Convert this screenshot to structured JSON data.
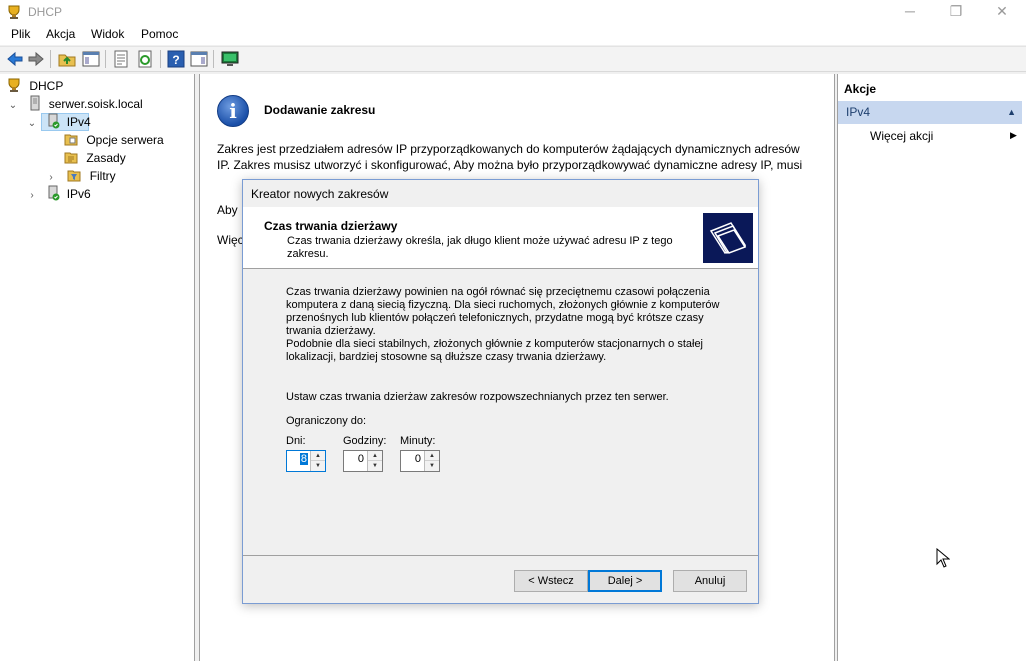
{
  "window": {
    "title": "DHCP",
    "controls": {
      "minimize": "─",
      "maximize": "❐",
      "close": "✕"
    }
  },
  "menu": [
    "Plik",
    "Akcja",
    "Widok",
    "Pomoc"
  ],
  "toolbar": {
    "icons": [
      "back-icon",
      "forward-icon",
      "up-folder-icon",
      "show-hide-tree-icon",
      "properties-icon",
      "refresh-icon",
      "help-icon",
      "show-hide-action-pane-icon",
      "console-icon"
    ]
  },
  "tree": {
    "items": [
      {
        "label": "DHCP",
        "icon": "dhcp-icon"
      },
      {
        "label": "serwer.soisk.local",
        "icon": "server-icon"
      },
      {
        "label": "IPv4",
        "icon": "ipv4-icon"
      },
      {
        "label": "Opcje serwera",
        "icon": "server-options-icon"
      },
      {
        "label": "Zasady",
        "icon": "policies-icon"
      },
      {
        "label": "Filtry",
        "icon": "filters-icon"
      },
      {
        "label": "IPv6",
        "icon": "ipv6-icon"
      }
    ]
  },
  "center": {
    "heading": "Dodawanie zakresu",
    "para1": "Zakres jest przedziałem adresów IP przyporządkowanych do komputerów żądających dynamicznych adresów IP. Zakres musisz utworzyć i skonfigurować, Aby można było przyporządkowywać dynamiczne adresy IP, musi",
    "para2": "Aby",
    "para3": "Więc"
  },
  "actions": {
    "header": "Akcje",
    "section": "IPv4",
    "more": "Więcej akcji"
  },
  "wizard": {
    "title": "Kreator nowych zakresów",
    "heading": "Czas trwania dzierżawy",
    "subheading": "Czas trwania dzierżawy określa, jak długo klient może używać adresu IP z tego zakresu.",
    "body1": "Czas trwania dzierżawy powinien na ogół równać się przeciętnemu czasowi połączenia komputera z daną siecią fizyczną. Dla sieci ruchomych, złożonych głównie z komputerów przenośnych lub klientów połączeń telefonicznych, przydatne mogą być krótsze czasy trwania dzierżawy.",
    "body2": "Podobnie dla sieci stabilnych, złożonych głównie z komputerów stacjonarnych o stałej lokalizacji, bardziej stosowne są dłuższe czasy trwania dzierżawy.",
    "instruction": "Ustaw czas trwania dzierżaw zakresów rozpowszechnianych przez ten serwer.",
    "limited": "Ograniczony do:",
    "days_label": "Dni:",
    "days_value": "8",
    "hours_label": "Godziny:",
    "hours_value": "0",
    "minutes_label": "Minuty:",
    "minutes_value": "0",
    "back": "< Wstecz",
    "next": "Dalej >",
    "cancel": "Anuluj"
  }
}
